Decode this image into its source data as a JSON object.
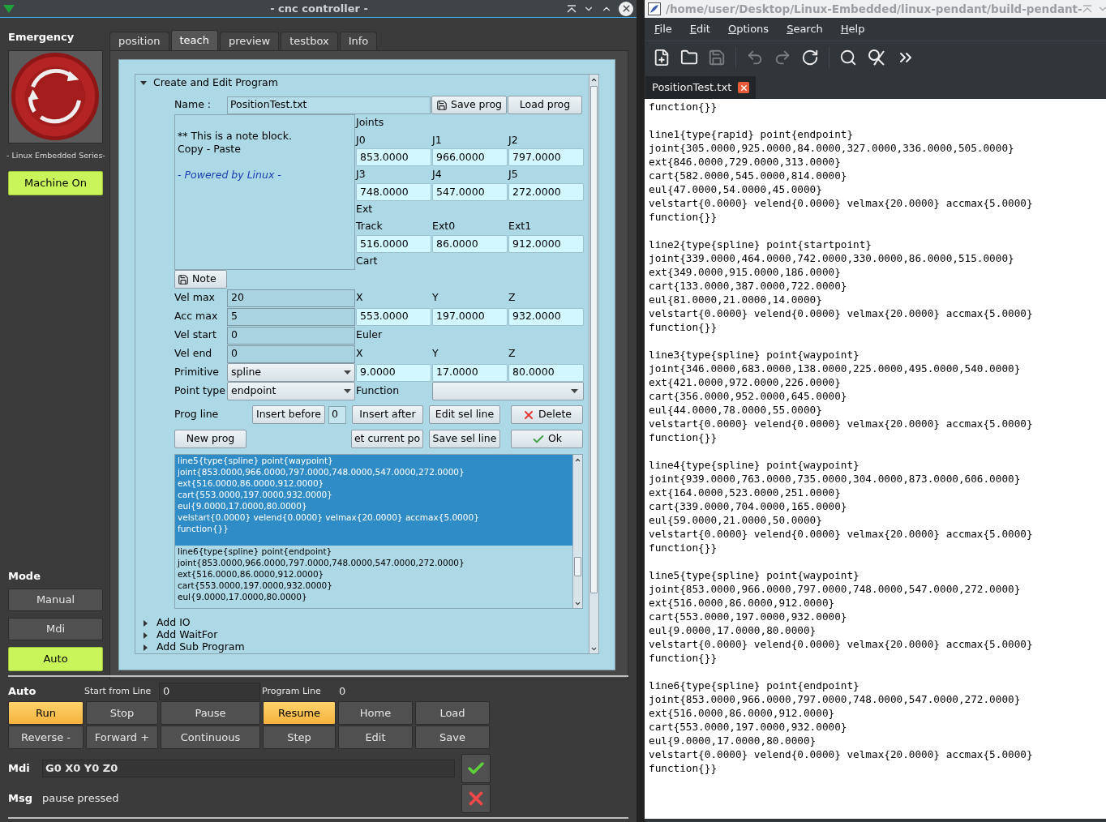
{
  "window": {
    "title": "- cnc controller -"
  },
  "emergency": {
    "label": "Emergency",
    "caption": "- Linux Embedded Series-"
  },
  "machine_button": {
    "label": "Machine On",
    "on": true
  },
  "mode": {
    "label": "Mode",
    "buttons": [
      {
        "label": "Manual",
        "selected": false
      },
      {
        "label": "Mdi",
        "selected": false
      },
      {
        "label": "Auto",
        "selected": true
      }
    ]
  },
  "tabs": [
    {
      "label": "position",
      "selected": false
    },
    {
      "label": "teach",
      "selected": true
    },
    {
      "label": "preview",
      "selected": false
    },
    {
      "label": "testbox",
      "selected": false
    },
    {
      "label": "Info",
      "selected": false
    }
  ],
  "teach": {
    "sections": [
      {
        "title": "Create and Edit Program",
        "expanded": true
      },
      {
        "title": "Add IO",
        "expanded": false
      },
      {
        "title": "Add WaitFor",
        "expanded": false
      },
      {
        "title": "Add Sub Program",
        "expanded": false
      }
    ],
    "name": {
      "label": "Name :",
      "value": "PositionTest.txt",
      "save": "Save prog",
      "load": "Load prog"
    },
    "note": {
      "lines": [
        "** This is a note block.",
        "Copy - Paste"
      ],
      "footer": "- Powered by Linux -",
      "button": "Note"
    },
    "groups": [
      {
        "title": "Joints",
        "rows": [
          [
            {
              "label": "J0",
              "value": "853.0000"
            },
            {
              "label": "J1",
              "value": "966.0000"
            },
            {
              "label": "J2",
              "value": "797.0000"
            }
          ],
          [
            {
              "label": "J3",
              "value": "748.0000"
            },
            {
              "label": "J4",
              "value": "547.0000"
            },
            {
              "label": "J5",
              "value": "272.0000"
            }
          ]
        ]
      },
      {
        "title": "Ext",
        "rows": [
          [
            {
              "label": "Track",
              "value": "516.0000"
            },
            {
              "label": "Ext0",
              "value": "86.0000"
            },
            {
              "label": "Ext1",
              "value": "912.0000"
            }
          ]
        ]
      },
      {
        "title": "Cart",
        "rows": [
          [
            {
              "label": "X",
              "value": "553.0000"
            },
            {
              "label": "Y",
              "value": "197.0000"
            },
            {
              "label": "Z",
              "value": "932.0000"
            }
          ]
        ]
      },
      {
        "title": "Euler",
        "rows": [
          [
            {
              "label": "X",
              "value": "9.0000"
            },
            {
              "label": "Y",
              "value": "17.0000"
            },
            {
              "label": "Z",
              "value": "80.0000"
            }
          ]
        ]
      }
    ],
    "params": [
      {
        "label": "Vel max",
        "value": "20",
        "kind": "text"
      },
      {
        "label": "Acc max",
        "value": "5",
        "kind": "text"
      },
      {
        "label": "Vel start",
        "value": "0",
        "kind": "text"
      },
      {
        "label": "Vel end",
        "value": "0",
        "kind": "text"
      },
      {
        "label": "Primitive",
        "value": "spline",
        "kind": "select"
      },
      {
        "label": "Point type",
        "value": "endpoint",
        "kind": "select"
      }
    ],
    "function": {
      "label": "Function"
    },
    "prog_line": {
      "label": "Prog line",
      "insert_before": "Insert before",
      "index": "0",
      "insert_after": "Insert after",
      "edit": "Edit sel line",
      "delete": "Delete",
      "new": "New prog",
      "get_pos": "et current po",
      "save_line": "Save sel line",
      "ok": "Ok"
    },
    "program": [
      {
        "selected": true,
        "lines": [
          "line5{type{spline} point{waypoint}",
          "joint{853.0000,966.0000,797.0000,748.0000,547.0000,272.0000}",
          "ext{516.0000,86.0000,912.0000}",
          "cart{553.0000,197.0000,932.0000}",
          "eul{9.0000,17.0000,80.0000}",
          "velstart{0.0000} velend{0.0000} velmax{20.0000} accmax{5.0000}",
          "function{}}"
        ]
      },
      {
        "selected": false,
        "lines": [
          "line6{type{spline} point{endpoint}",
          "joint{853.0000,966.0000,797.0000,748.0000,547.0000,272.0000}",
          "ext{516.0000,86.0000,912.0000}",
          "cart{553.0000,197.0000,932.0000}",
          "eul{9.0000,17.0000,80.0000}"
        ]
      }
    ]
  },
  "auto": {
    "label": "Auto",
    "start_label": "Start from Line",
    "start_value": "0",
    "line_label": "Program Line",
    "line_value": "0",
    "buttons": [
      {
        "label": "Run",
        "active": true
      },
      {
        "label": "Stop",
        "active": false
      },
      {
        "label": "Pause",
        "active": false
      },
      {
        "label": "Resume",
        "active": true
      },
      {
        "label": "Home",
        "active": false
      },
      {
        "label": "Load",
        "active": false
      },
      {
        "label": "Reverse -",
        "active": false
      },
      {
        "label": "Forward +",
        "active": false
      },
      {
        "label": "Continuous",
        "active": false
      },
      {
        "label": "Step",
        "active": false
      },
      {
        "label": "Edit",
        "active": false
      },
      {
        "label": "Save",
        "active": false
      }
    ]
  },
  "mdi": {
    "label": "Mdi",
    "value": "G0 X0 Y0 Z0"
  },
  "msg": {
    "label": "Msg",
    "text": "pause pressed"
  },
  "editor": {
    "title": "/home/user/Desktop/Linux-Embedded/linux-pendant/build-pendant-",
    "menu": [
      "File",
      "Edit",
      "Options",
      "Search",
      "Help"
    ],
    "tab": "PositionTest.txt",
    "blocks": [
      [
        "function{}}"
      ],
      [
        "line1{type{rapid} point{endpoint}",
        "joint{305.0000,925.0000,84.0000,327.0000,336.0000,505.0000}",
        "ext{846.0000,729.0000,313.0000}",
        "cart{582.0000,545.0000,814.0000}",
        "eul{47.0000,54.0000,45.0000}",
        "velstart{0.0000} velend{0.0000} velmax{20.0000} accmax{5.0000}",
        "function{}}"
      ],
      [
        "line2{type{spline} point{startpoint}",
        "joint{339.0000,464.0000,742.0000,330.0000,86.0000,515.0000}",
        "ext{349.0000,915.0000,186.0000}",
        "cart{133.0000,387.0000,722.0000}",
        "eul{81.0000,21.0000,14.0000}",
        "velstart{0.0000} velend{0.0000} velmax{20.0000} accmax{5.0000}",
        "function{}}"
      ],
      [
        "line3{type{spline} point{waypoint}",
        "joint{346.0000,683.0000,138.0000,225.0000,495.0000,540.0000}",
        "ext{421.0000,972.0000,226.0000}",
        "cart{356.0000,952.0000,645.0000}",
        "eul{44.0000,78.0000,55.0000}",
        "velstart{0.0000} velend{0.0000} velmax{20.0000} accmax{5.0000}",
        "function{}}"
      ],
      [
        "line4{type{spline} point{waypoint}",
        "joint{939.0000,763.0000,735.0000,304.0000,873.0000,606.0000}",
        "ext{164.0000,523.0000,251.0000}",
        "cart{339.0000,704.0000,165.0000}",
        "eul{59.0000,21.0000,50.0000}",
        "velstart{0.0000} velend{0.0000} velmax{20.0000} accmax{5.0000}",
        "function{}}"
      ],
      [
        "line5{type{spline} point{waypoint}",
        "joint{853.0000,966.0000,797.0000,748.0000,547.0000,272.0000}",
        "ext{516.0000,86.0000,912.0000}",
        "cart{553.0000,197.0000,932.0000}",
        "eul{9.0000,17.0000,80.0000}",
        "velstart{0.0000} velend{0.0000} velmax{20.0000} accmax{5.0000}",
        "function{}}"
      ],
      [
        "line6{type{spline} point{endpoint}",
        "joint{853.0000,966.0000,797.0000,748.0000,547.0000,272.0000}",
        "ext{516.0000,86.0000,912.0000}",
        "cart{553.0000,197.0000,932.0000}",
        "eul{9.0000,17.0000,80.0000}",
        "velstart{0.0000} velend{0.0000} velmax{20.0000} accmax{5.0000}",
        "function{}}"
      ]
    ]
  }
}
